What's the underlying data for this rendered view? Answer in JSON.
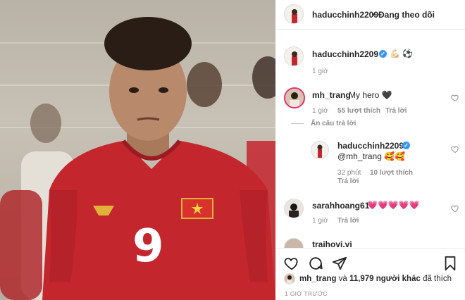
{
  "header": {
    "username": "haducchinh2209",
    "separator": "•",
    "follow_label": "Đang theo dõi"
  },
  "caption": {
    "username": "haducchinh2209",
    "text": "💪🏻 ⚽",
    "time": "1 giờ"
  },
  "comments": [
    {
      "username": "mh_trang",
      "text": "My hero 🖤",
      "time": "1 giờ",
      "likes": "55 lượt thích",
      "reply_label": "Trả lời",
      "hide_replies": "Ẩn câu trả lời"
    },
    {
      "username": "haducchinh2209",
      "text": "@mh_trang 🥰🥰",
      "time": "32 phút",
      "likes": "10 lượt thích",
      "reply_label": "Trả lời"
    },
    {
      "username": "sarahhoang61",
      "text": "💗💗💗💗💗",
      "time": "1 giờ",
      "reply_label": "Trả lời"
    },
    {
      "username": "traihovi.vi",
      "text": ""
    }
  ],
  "likes_bar": {
    "liker": "mh_trang",
    "connector": "và",
    "others": "11,979 người khác",
    "suffix": "đã thích"
  },
  "footer_time": "1 GIỜ TRƯỚC",
  "photo": {
    "jersey_number": "9"
  },
  "colors": {
    "jersey_red": "#c4262e",
    "verified_blue": "#3897f0",
    "muted_text": "#8e8e8e"
  }
}
